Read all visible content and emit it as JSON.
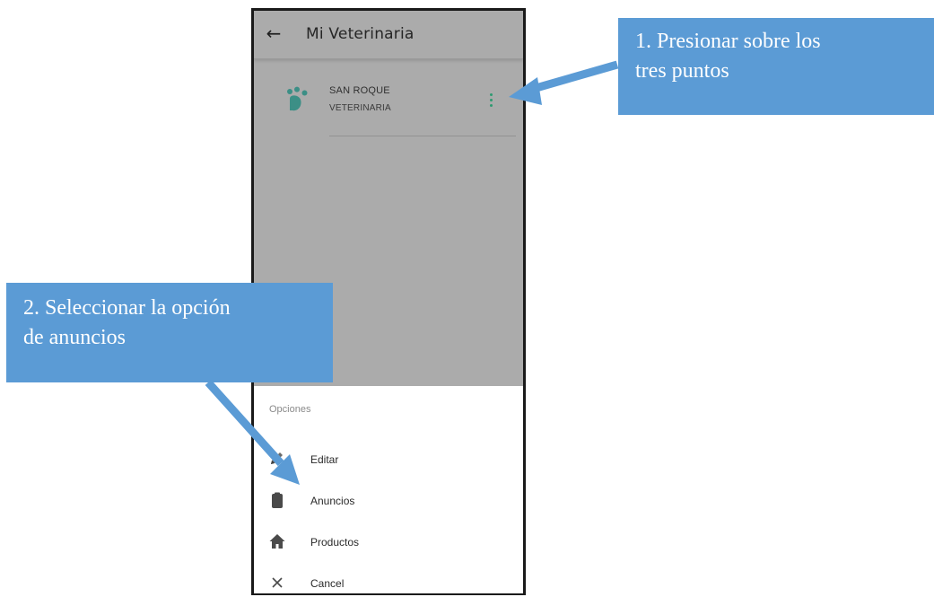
{
  "app_bar": {
    "back_icon": "arrow-left-icon",
    "title": "Mi Veterinaria"
  },
  "list_item": {
    "icon": "paw-icon",
    "title": "SAN ROQUE",
    "subtitle": "VETERINARIA",
    "menu_icon": "more-vertical-icon"
  },
  "bottom_sheet": {
    "header": "Opciones",
    "items": [
      {
        "label": "Editar",
        "icon": "edit-pencil-icon"
      },
      {
        "label": "Anuncios",
        "icon": "clipboard-icon"
      },
      {
        "label": "Productos",
        "icon": "home-icon"
      },
      {
        "label": "Cancel",
        "icon": "close-icon"
      }
    ]
  },
  "annotations": [
    {
      "line1": "1. Presionar sobre los",
      "line2": "tres puntos"
    },
    {
      "line1": "2. Seleccionar la opción",
      "line2": "de anuncios"
    }
  ],
  "colors": {
    "scrim": "#ababab",
    "accent_green": "#2e9a71",
    "paw_teal": "#3c8f86",
    "annotation_blue": "#5b9bd5"
  }
}
